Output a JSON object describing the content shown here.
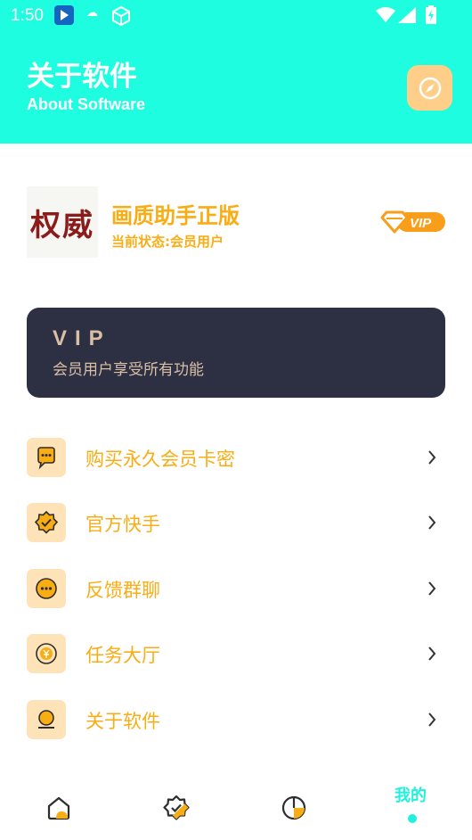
{
  "status_bar": {
    "time": "1:50",
    "icons": [
      "app-notification-icon",
      "cloud-icon",
      "box-icon",
      "wifi-icon",
      "signal-icon",
      "battery-icon"
    ]
  },
  "header": {
    "title": "关于软件",
    "subtitle": "About Software",
    "action_icon": "compass-icon",
    "background": "#1ffde0"
  },
  "profile": {
    "logo_text": "权威",
    "app_name": "画质助手正版",
    "status_label": "当前状态:",
    "status_value": "会员用户",
    "badge": "VIP"
  },
  "vip_card": {
    "title": "VIP",
    "description": "会员用户享受所有功能",
    "background": "#2d3043"
  },
  "menu": [
    {
      "label": "购买永久会员卡密",
      "icon": "chat-bubble-icon"
    },
    {
      "label": "官方快手",
      "icon": "verified-badge-icon"
    },
    {
      "label": "反馈群聊",
      "icon": "message-dots-icon"
    },
    {
      "label": "任务大厅",
      "icon": "coin-icon"
    },
    {
      "label": "关于软件",
      "icon": "user-icon"
    }
  ],
  "tabbar": {
    "tabs": [
      {
        "icon": "home-icon",
        "label": ""
      },
      {
        "icon": "verified-badge-icon",
        "label": ""
      },
      {
        "icon": "pie-chart-icon",
        "label": ""
      },
      {
        "icon": "",
        "label": "我的",
        "active": true
      }
    ]
  },
  "colors": {
    "accent": "#f9ad14",
    "teal": "#1ffde0",
    "icon_bg": "#ffe3b8"
  }
}
